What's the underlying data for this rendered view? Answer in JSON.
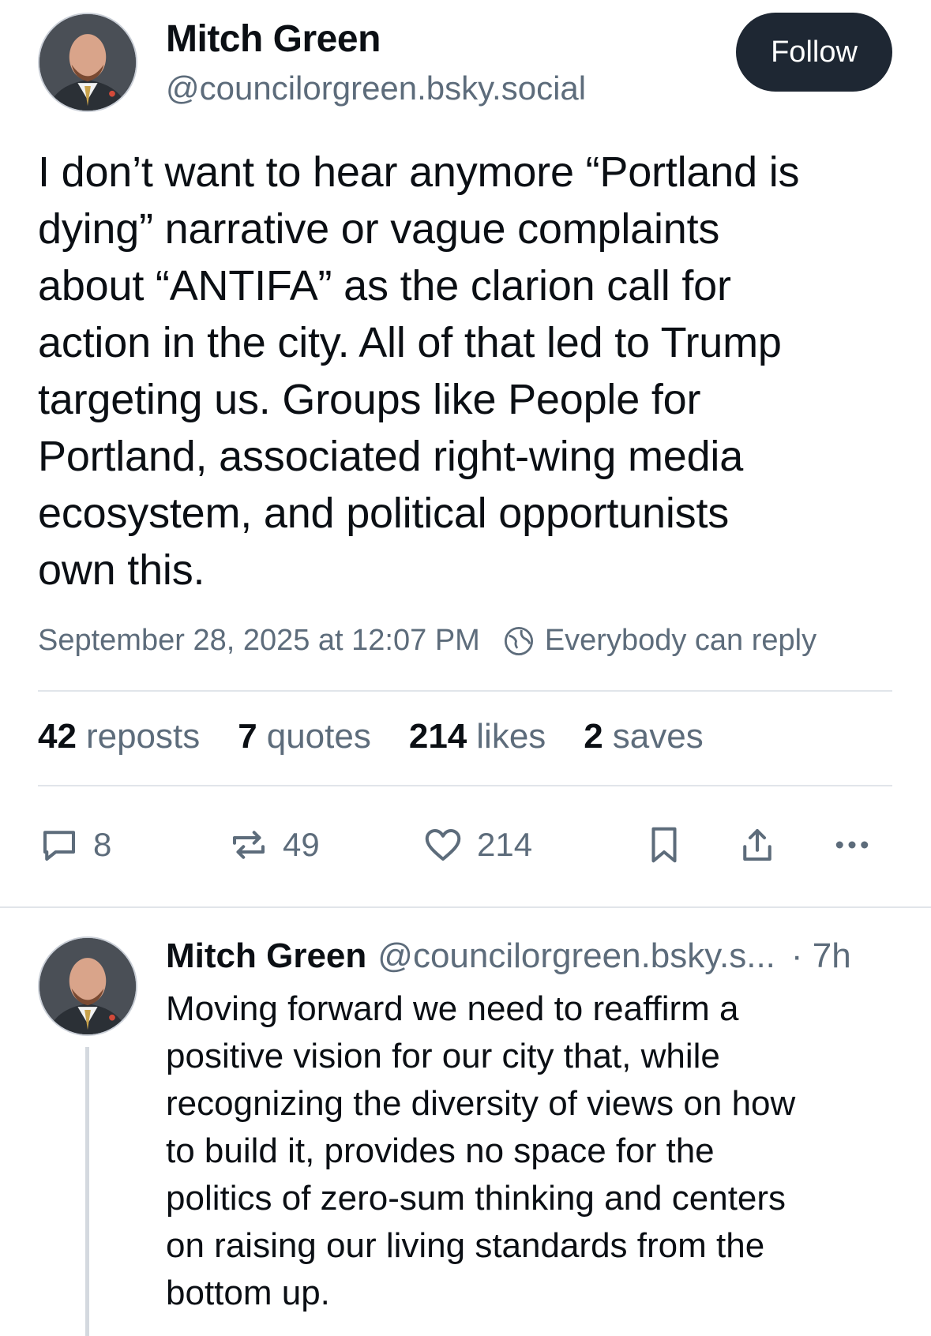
{
  "post": {
    "author_name": "Mitch Green",
    "author_handle": "@councilorgreen.bsky.social",
    "follow_label": "Follow",
    "text": "I don’t want to hear anymore “Portland is\ndying” narrative or vague complaints\nabout “ANTIFA” as the clarion call for\naction in the city. All of that led to Trump\ntargeting us. Groups like People for\nPortland, associated right-wing media\necosystem, and political opportunists\nown this.",
    "timestamp": "September 28, 2025 at 12:07 PM",
    "reply_setting": "Everybody can reply",
    "reply_setting_icon": "globe-icon",
    "stats": {
      "reposts_count": "42",
      "reposts_label": "reposts",
      "quotes_count": "7",
      "quotes_label": "quotes",
      "likes_count": "214",
      "likes_label": "likes",
      "saves_count": "2",
      "saves_label": "saves"
    },
    "actions": {
      "reply_count": "8",
      "repost_count": "49",
      "like_count": "214"
    }
  },
  "reply": {
    "author_name": "Mitch Green",
    "author_handle": "@councilorgreen.bsky.s...",
    "time": "· 7h",
    "text": "Moving forward we need to reaffirm a\npositive vision for our city that, while\nrecognizing the diversity of views on how\nto build it, provides no space for the\npolitics of zero-sum thinking and centers\non raising our living standards from the\nbottom up."
  },
  "colors": {
    "text_primary": "#0b0f14",
    "text_secondary": "#5d6c7b",
    "follow_bg": "#1e2733",
    "divider": "#e1e5ea"
  }
}
